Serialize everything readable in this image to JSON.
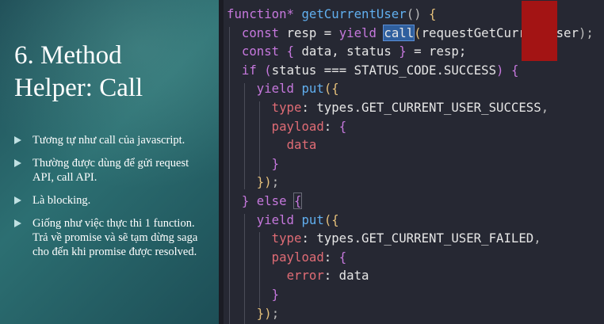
{
  "slide": {
    "title_line1": "6. Method",
    "title_line2": "Helper: Call",
    "bullets": [
      "Tương tự như call của javascript.",
      "Thường được dùng để gửi request API, call API.",
      "Là blocking.",
      "Giống như việc thực thi 1 function. Trả về promise và sẽ tạm dừng saga cho đến khi promise được resolved."
    ]
  },
  "code": {
    "lines": [
      [
        {
          "t": "function*",
          "c": "kw"
        },
        {
          "t": " ",
          "c": "ident"
        },
        {
          "t": "getCurrentUser",
          "c": "fn"
        },
        {
          "t": "() ",
          "c": "punc"
        },
        {
          "t": "{",
          "c": "brace-y"
        }
      ],
      [
        {
          "t": "  ",
          "c": "ident"
        },
        {
          "t": "const",
          "c": "kw"
        },
        {
          "t": " resp = ",
          "c": "ident"
        },
        {
          "t": "yield",
          "c": "kw"
        },
        {
          "t": " ",
          "c": "ident"
        },
        {
          "t": "call",
          "c": "fn hl"
        },
        {
          "t": "(",
          "c": "brace-y"
        },
        {
          "t": "requestGetCurrentUser",
          "c": "ident"
        },
        {
          "t": ");",
          "c": "punc"
        }
      ],
      [
        {
          "t": "  ",
          "c": "ident"
        },
        {
          "t": "const",
          "c": "kw"
        },
        {
          "t": " ",
          "c": "ident"
        },
        {
          "t": "{",
          "c": "brace-p"
        },
        {
          "t": " data, status ",
          "c": "ident"
        },
        {
          "t": "}",
          "c": "brace-p"
        },
        {
          "t": " = resp;",
          "c": "ident"
        }
      ],
      [
        {
          "t": "  ",
          "c": "ident"
        },
        {
          "t": "if",
          "c": "kw"
        },
        {
          "t": " ",
          "c": "ident"
        },
        {
          "t": "(",
          "c": "brace-p"
        },
        {
          "t": "status === STATUS_CODE.SUCCESS",
          "c": "ident"
        },
        {
          "t": ")",
          "c": "brace-p"
        },
        {
          "t": " ",
          "c": "ident"
        },
        {
          "t": "{",
          "c": "brace-p"
        }
      ],
      [
        {
          "t": "    ",
          "c": "ident"
        },
        {
          "t": "yield",
          "c": "kw"
        },
        {
          "t": " ",
          "c": "ident"
        },
        {
          "t": "put",
          "c": "fn"
        },
        {
          "t": "(",
          "c": "brace-y"
        },
        {
          "t": "{",
          "c": "brace-y"
        }
      ],
      [
        {
          "t": "      ",
          "c": "ident"
        },
        {
          "t": "type",
          "c": "prop"
        },
        {
          "t": ": types.",
          "c": "ident"
        },
        {
          "t": "GET_CURRENT_USER_SUCCESS",
          "c": "ident"
        },
        {
          "t": ",",
          "c": "punc"
        }
      ],
      [
        {
          "t": "      ",
          "c": "ident"
        },
        {
          "t": "payload",
          "c": "prop"
        },
        {
          "t": ": ",
          "c": "ident"
        },
        {
          "t": "{",
          "c": "brace-p"
        }
      ],
      [
        {
          "t": "        ",
          "c": "ident"
        },
        {
          "t": "data",
          "c": "prop"
        }
      ],
      [
        {
          "t": "      ",
          "c": "ident"
        },
        {
          "t": "}",
          "c": "brace-p"
        }
      ],
      [
        {
          "t": "    ",
          "c": "ident"
        },
        {
          "t": "}",
          "c": "brace-y"
        },
        {
          "t": ")",
          "c": "brace-y"
        },
        {
          "t": ";",
          "c": "punc"
        }
      ],
      [
        {
          "t": "  ",
          "c": "ident"
        },
        {
          "t": "}",
          "c": "brace-p"
        },
        {
          "t": " ",
          "c": "ident"
        },
        {
          "t": "else",
          "c": "kw"
        },
        {
          "t": " ",
          "c": "ident"
        },
        {
          "t": "{",
          "c": "brace-p bracket-box"
        }
      ],
      [
        {
          "t": "    ",
          "c": "ident"
        },
        {
          "t": "yield",
          "c": "kw"
        },
        {
          "t": " ",
          "c": "ident"
        },
        {
          "t": "put",
          "c": "fn"
        },
        {
          "t": "(",
          "c": "brace-y"
        },
        {
          "t": "{",
          "c": "brace-y"
        }
      ],
      [
        {
          "t": "      ",
          "c": "ident"
        },
        {
          "t": "type",
          "c": "prop"
        },
        {
          "t": ": types.",
          "c": "ident"
        },
        {
          "t": "GET_CURRENT_USER_FAILED",
          "c": "ident"
        },
        {
          "t": ",",
          "c": "punc"
        }
      ],
      [
        {
          "t": "      ",
          "c": "ident"
        },
        {
          "t": "payload",
          "c": "prop"
        },
        {
          "t": ": ",
          "c": "ident"
        },
        {
          "t": "{",
          "c": "brace-p"
        }
      ],
      [
        {
          "t": "        ",
          "c": "ident"
        },
        {
          "t": "error",
          "c": "prop"
        },
        {
          "t": ": data",
          "c": "ident"
        }
      ],
      [
        {
          "t": "      ",
          "c": "ident"
        },
        {
          "t": "}",
          "c": "brace-p"
        }
      ],
      [
        {
          "t": "    ",
          "c": "ident"
        },
        {
          "t": "}",
          "c": "brace-y"
        },
        {
          "t": ")",
          "c": "brace-y"
        },
        {
          "t": ";",
          "c": "punc"
        }
      ]
    ]
  },
  "colors": {
    "slide_bg": "#2c6f72",
    "code_bg": "#262833",
    "keyword": "#c678dd",
    "function": "#61afef",
    "property": "#e06c75",
    "bracket": "#e5c07b",
    "redaction": "#a31414"
  },
  "icons": {
    "bullet": "triangle-right-icon"
  }
}
